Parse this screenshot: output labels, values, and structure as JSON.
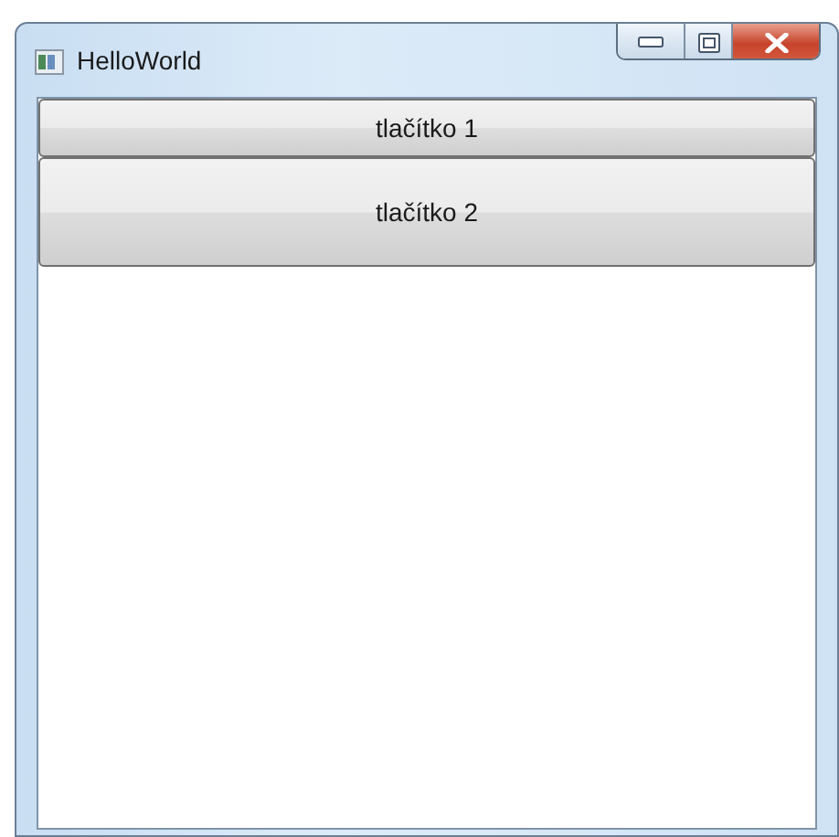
{
  "window": {
    "title": "HelloWorld"
  },
  "buttons": [
    {
      "label": "tlačítko 1",
      "kind": "short"
    },
    {
      "label": "tlačítko 2",
      "kind": "tall"
    }
  ]
}
